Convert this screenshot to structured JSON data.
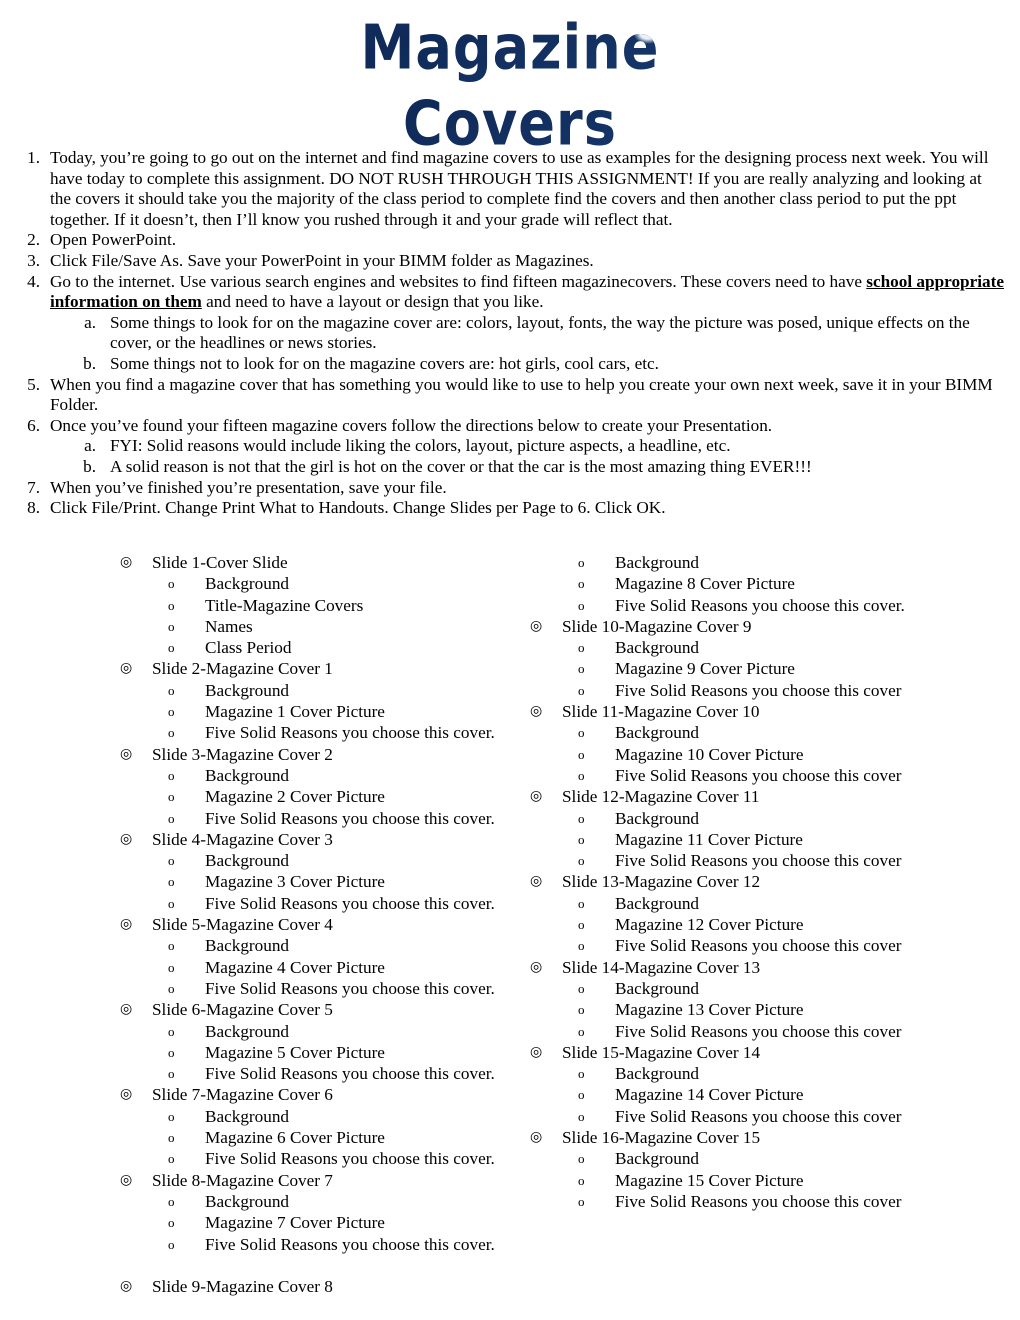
{
  "document": {
    "title_line1": "Magazine",
    "title_line2": "Covers",
    "title_color": "#15356b"
  },
  "instructions": [
    {
      "marker": "1.",
      "text": "Today, you’re going to go out on the internet and find magazine covers to use as examples for the designing process next week. You will have today to complete this assignment. DO NOT RUSH THROUGH THIS ASSIGNMENT! If you are really analyzing and looking at the covers it should take you the majority of the class period to complete find the covers and then another class period to put the ppt together. If it doesn’t, then I’ll know you rushed through it and your grade will reflect that."
    },
    {
      "marker": "2.",
      "text": "Open PowerPoint."
    },
    {
      "marker": "3.",
      "text": "Click File/Save As. Save your PowerPoint in your BIMM folder as Magazines."
    },
    {
      "marker": "4.",
      "text_before": "Go to the internet. Use various search engines and websites to find fifteen magazinecovers. These covers need to have ",
      "emphasis": "school appropriate information on them",
      "text_after": " and need to have a layout or design that you like.",
      "subitems": [
        {
          "marker": "a.",
          "text": "Some things to look for on the magazine cover are: colors, layout, fonts, the way the picture was posed, unique effects on the cover, or the headlines or news stories."
        },
        {
          "marker": "b.",
          "text": "Some things not to look for on the magazine covers are: hot girls, cool cars, etc."
        }
      ]
    },
    {
      "marker": "5.",
      "text": "When you find a magazine cover that has something you would like to use to help you create your own next week, save it in your BIMM Folder."
    },
    {
      "marker": "6.",
      "text": "Once you’ve found your fifteen magazine covers follow the directions below to create your Presentation.",
      "subitems": [
        {
          "marker": "a.",
          "text": "FYI: Solid reasons would include liking the colors, layout, picture aspects, a headline, etc."
        },
        {
          "marker": "b.",
          "text": " A solid reason is not that the girl is hot on the cover or that the car is the most amazing thing EVER!!!"
        }
      ]
    },
    {
      "marker": "7.",
      "text": "When you’ve finished you’re presentation, save your file."
    },
    {
      "marker": "8.",
      "text": "Click File/Print. Change Print What to Handouts. Change Slides per Page to 6. Click OK."
    }
  ],
  "bullets": {
    "level1_glyph": "◎",
    "level2_glyph": "o"
  },
  "outline": {
    "left_column": [
      {
        "type": "lvl1",
        "text": "Slide 1-Cover Slide"
      },
      {
        "type": "lvl2",
        "text": "Background"
      },
      {
        "type": "lvl2",
        "text": "Title-Magazine Covers"
      },
      {
        "type": "lvl2",
        "text": "Names"
      },
      {
        "type": "lvl2",
        "text": "Class Period"
      },
      {
        "type": "lvl1",
        "text": "Slide 2-Magazine Cover 1"
      },
      {
        "type": "lvl2",
        "text": "Background"
      },
      {
        "type": "lvl2",
        "text": "Magazine 1 Cover Picture"
      },
      {
        "type": "lvl2",
        "text": "Five Solid Reasons you choose this cover."
      },
      {
        "type": "lvl1",
        "text": "Slide 3-Magazine Cover 2"
      },
      {
        "type": "lvl2",
        "text": "Background"
      },
      {
        "type": "lvl2",
        "text": "Magazine 2 Cover Picture"
      },
      {
        "type": "lvl2",
        "text": "Five Solid Reasons you choose this cover."
      },
      {
        "type": "lvl1",
        "text": "Slide 4-Magazine Cover 3"
      },
      {
        "type": "lvl2",
        "text": "Background"
      },
      {
        "type": "lvl2",
        "text": "Magazine 3 Cover Picture"
      },
      {
        "type": "lvl2",
        "text": "Five Solid Reasons you choose this cover."
      },
      {
        "type": "lvl1",
        "text": "Slide 5-Magazine Cover 4"
      },
      {
        "type": "lvl2",
        "text": "Background"
      },
      {
        "type": "lvl2",
        "text": "Magazine 4 Cover Picture"
      },
      {
        "type": "lvl2",
        "text": "Five Solid Reasons you choose this cover."
      },
      {
        "type": "lvl1",
        "text": "Slide 6-Magazine Cover 5"
      },
      {
        "type": "lvl2",
        "text": "Background"
      },
      {
        "type": "lvl2",
        "text": "Magazine 5 Cover Picture"
      },
      {
        "type": "lvl2",
        "text": "Five Solid Reasons you choose this cover."
      },
      {
        "type": "lvl1",
        "text": "Slide 7-Magazine Cover 6"
      },
      {
        "type": "lvl2",
        "text": "Background"
      },
      {
        "type": "lvl2",
        "text": "Magazine 6 Cover Picture"
      },
      {
        "type": "lvl2",
        "text": "Five Solid Reasons you choose this cover."
      },
      {
        "type": "lvl1",
        "text": "Slide 8-Magazine Cover 7"
      },
      {
        "type": "lvl2",
        "text": "Background"
      },
      {
        "type": "lvl2",
        "text": "Magazine 7 Cover Picture"
      },
      {
        "type": "lvl2",
        "text": "Five Solid Reasons you choose this cover."
      },
      {
        "type": "blank"
      },
      {
        "type": "lvl1",
        "text": "Slide 9-Magazine Cover 8"
      }
    ],
    "right_column": [
      {
        "type": "lvl2",
        "text": "Background"
      },
      {
        "type": "lvl2",
        "text": "Magazine 8 Cover Picture"
      },
      {
        "type": "lvl2",
        "text": "Five Solid Reasons you choose this cover."
      },
      {
        "type": "lvl1",
        "text": "Slide 10-Magazine Cover 9"
      },
      {
        "type": "lvl2",
        "text": "Background"
      },
      {
        "type": "lvl2",
        "text": "Magazine 9 Cover Picture"
      },
      {
        "type": "lvl2",
        "text": "Five Solid Reasons you choose this cover"
      },
      {
        "type": "lvl1",
        "text": "Slide 11-Magazine Cover 10"
      },
      {
        "type": "lvl2",
        "text": "Background"
      },
      {
        "type": "lvl2",
        "text": "Magazine 10 Cover Picture"
      },
      {
        "type": "lvl2",
        "text": "Five Solid Reasons you choose this cover"
      },
      {
        "type": "lvl1",
        "text": "Slide 12-Magazine Cover 11"
      },
      {
        "type": "lvl2",
        "text": "Background"
      },
      {
        "type": "lvl2",
        "text": "Magazine 11 Cover Picture"
      },
      {
        "type": "lvl2",
        "text": "Five Solid Reasons you choose this cover"
      },
      {
        "type": "lvl1",
        "text": "Slide 13-Magazine Cover 12"
      },
      {
        "type": "lvl2",
        "text": "Background"
      },
      {
        "type": "lvl2",
        "text": "Magazine 12 Cover Picture"
      },
      {
        "type": "lvl2",
        "text": "Five Solid Reasons you choose this cover"
      },
      {
        "type": "lvl1",
        "text": "Slide 14-Magazine Cover 13"
      },
      {
        "type": "lvl2",
        "text": "Background"
      },
      {
        "type": "lvl2",
        "text": "Magazine 13 Cover Picture"
      },
      {
        "type": "lvl2",
        "text": "Five Solid Reasons you choose this cover"
      },
      {
        "type": "lvl1",
        "text": "Slide 15-Magazine Cover 14"
      },
      {
        "type": "lvl2",
        "text": "Background"
      },
      {
        "type": "lvl2",
        "text": "Magazine 14 Cover Picture"
      },
      {
        "type": "lvl2",
        "text": "Five Solid Reasons you choose this cover"
      },
      {
        "type": "lvl1",
        "text": "Slide 16-Magazine Cover 15"
      },
      {
        "type": "lvl2",
        "text": "Background"
      },
      {
        "type": "lvl2",
        "text": "Magazine 15 Cover Picture"
      },
      {
        "type": "lvl2",
        "text": "Five Solid Reasons you choose this cover"
      }
    ]
  }
}
